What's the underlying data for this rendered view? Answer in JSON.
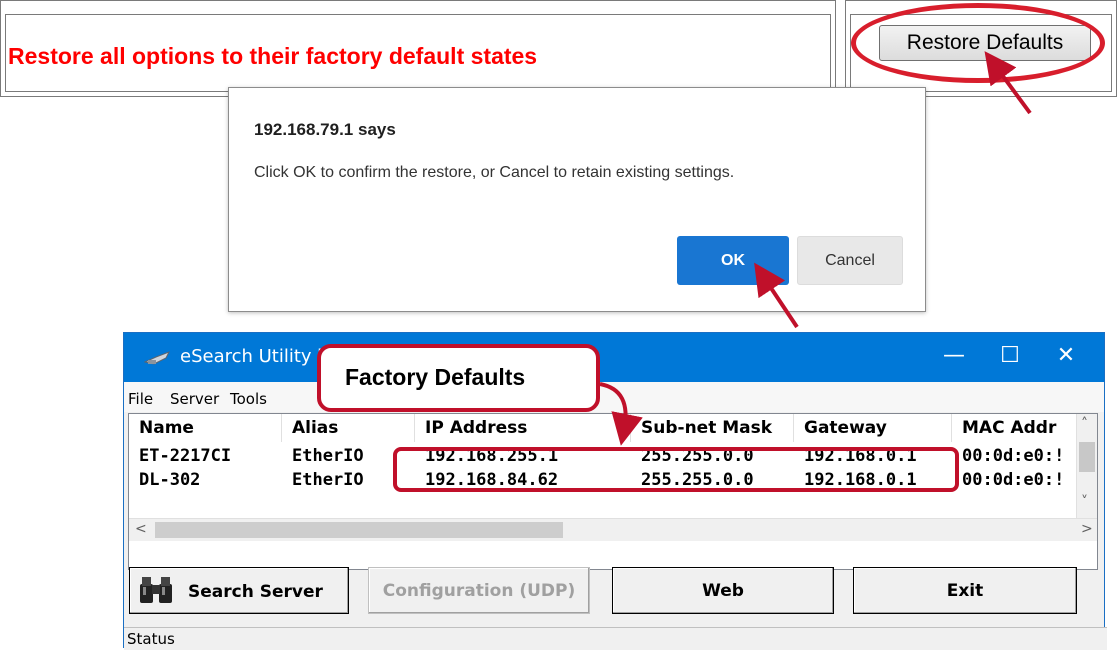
{
  "restore_panel": {
    "description": "Restore all options to their factory default states",
    "button_label": "Restore Defaults"
  },
  "dialog": {
    "title": "192.168.79.1 says",
    "message": "Click OK to confirm the restore, or Cancel to retain existing settings.",
    "ok_label": "OK",
    "cancel_label": "Cancel",
    "ok_color": "#1976d2"
  },
  "esearch": {
    "title": "eSearch Utility [",
    "titlebar_color": "#0078d7",
    "window_controls": [
      "minimize-icon",
      "maximize-icon",
      "close-icon"
    ],
    "menu": [
      "File",
      "Server",
      "Tools"
    ],
    "columns": [
      "Name",
      "Alias",
      "IP Address",
      "Sub-net Mask",
      "Gateway",
      "MAC Addr"
    ],
    "rows": [
      [
        "ET-2217CI",
        "EtherIO",
        "192.168.255.1",
        "255.255.0.0",
        "192.168.0.1",
        "00:0d:e0:!"
      ],
      [
        "DL-302",
        "EtherIO",
        "192.168.84.62",
        "255.255.0.0",
        "192.168.0.1",
        "00:0d:e0:!"
      ]
    ],
    "buttons": {
      "search": "Search Server",
      "config": "Configuration (UDP)",
      "web": "Web",
      "exit": "Exit"
    },
    "status": "Status"
  },
  "annotations": {
    "callout": "Factory Defaults",
    "accent_color": "#c0102a"
  }
}
